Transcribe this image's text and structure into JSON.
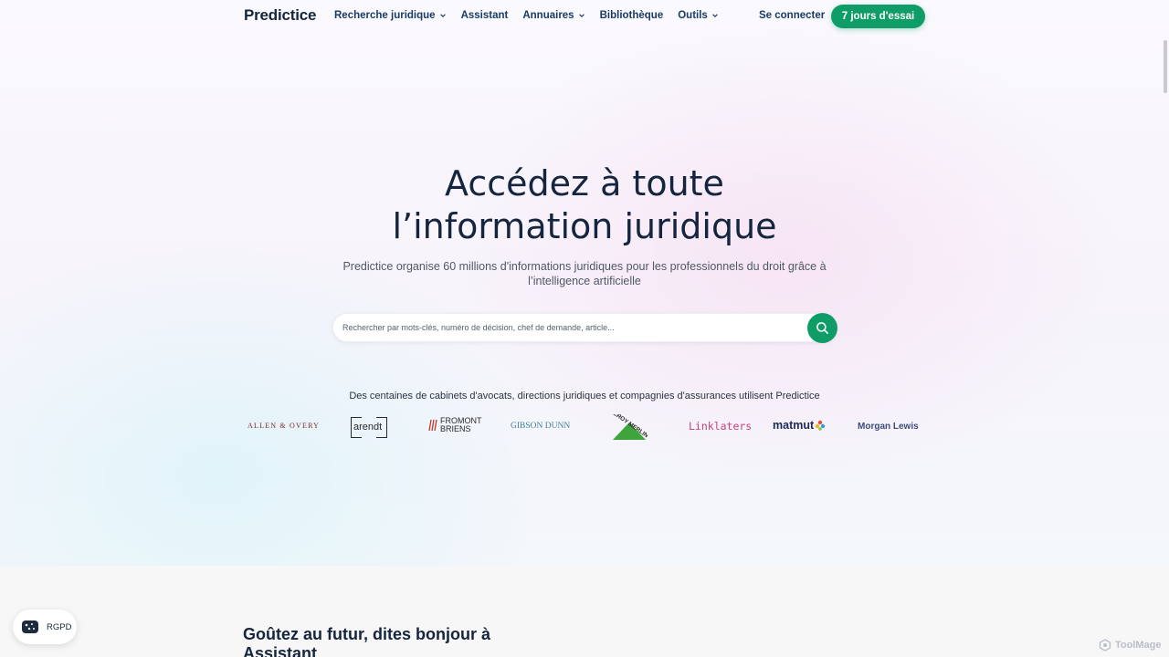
{
  "brand": {
    "name": "Predictice"
  },
  "nav": {
    "items": [
      {
        "label": "Recherche juridique",
        "has_dropdown": true
      },
      {
        "label": "Assistant",
        "has_dropdown": false
      },
      {
        "label": "Annuaires",
        "has_dropdown": true
      },
      {
        "label": "Bibliothèque",
        "has_dropdown": false
      },
      {
        "label": "Outils",
        "has_dropdown": true
      }
    ],
    "login_label": "Se connecter",
    "trial_label": "7 jours d'essai"
  },
  "hero": {
    "title_line1": "Accédez à toute",
    "title_line2": "l’information juridique",
    "subtitle_line1": "Predictice organise 60 millions d'informations juridiques pour les professionnels du droit grâce à",
    "subtitle_line2": "l’intelligence artificielle"
  },
  "search": {
    "placeholder": "Rechercher par mots-clés, numéro de décision, chef de demande, article...",
    "value": "",
    "button_icon": "search-icon"
  },
  "clients": {
    "headline": "Des centaines de cabinets d'avocats, directions juridiques et compagnies d'assurances utilisent Predictice",
    "logos": [
      {
        "name": "ALLEN & OVERY"
      },
      {
        "name": "arendt"
      },
      {
        "name": "FROMONT",
        "name2": "BRIENS"
      },
      {
        "name": "GIBSON DUNN"
      },
      {
        "name": "LEROY MERLIN"
      },
      {
        "name": "Linklaters"
      },
      {
        "name": "matmut"
      },
      {
        "name": "Morgan Lewis"
      }
    ]
  },
  "teaser": {
    "title_line1": "Goûtez au futur, dites bonjour à",
    "title_line2": "Assistant"
  },
  "cookie": {
    "label": "RGPD",
    "icon": "cookie-icon"
  },
  "watermark": {
    "label": "ToolMage"
  },
  "colors": {
    "primary_green": "#0f9d67",
    "navy": "#14253d",
    "nav_blue": "#1a3a66"
  }
}
